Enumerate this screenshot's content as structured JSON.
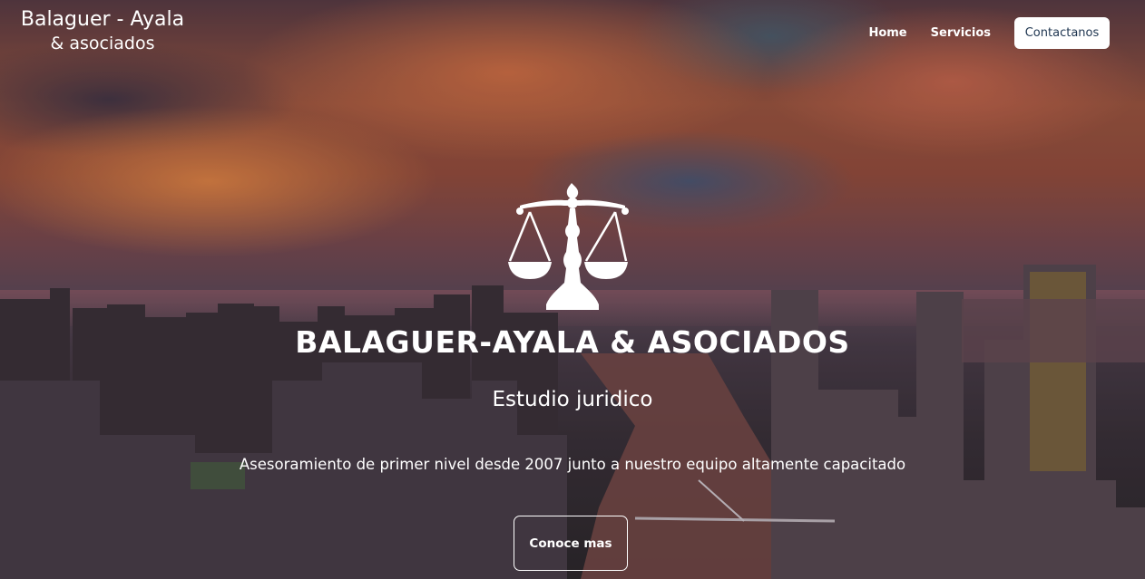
{
  "brand": {
    "line1": "Balaguer - Ayala",
    "line2": "& asociados"
  },
  "nav": {
    "items": [
      {
        "label": "Home"
      },
      {
        "label": "Servicios"
      }
    ],
    "cta_label": "Contactanos"
  },
  "hero": {
    "icon": "scales-of-justice-icon",
    "title": "BALAGUER-AYALA & ASOCIADOS",
    "subtitle": "Estudio juridico",
    "tagline": "Asesoramiento de primer nivel desde 2007 junto a nuestro equipo altamente capacitado",
    "cta_label": "Conoce mas"
  },
  "colors": {
    "text": "#ffffff",
    "cta_text": "#1e3550",
    "cta_background": "#ffffff"
  }
}
